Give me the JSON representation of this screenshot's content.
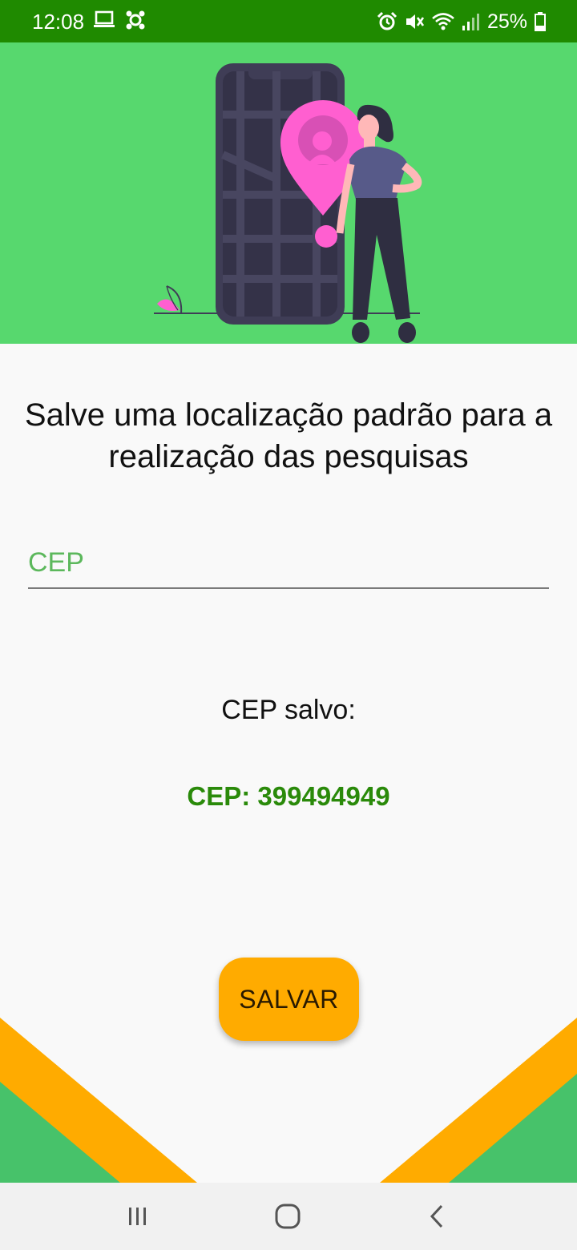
{
  "status_bar": {
    "time": "12:08",
    "battery_percent": "25%",
    "left_icons": [
      "laptop-icon",
      "app-notification-icon"
    ],
    "right_icons": [
      "alarm-icon",
      "mute-vibrate-icon",
      "wifi-icon",
      "signal-icon",
      "battery-icon"
    ],
    "background_color": "#1f8a00"
  },
  "hero": {
    "illustration": "woman-with-phone-map-pin-illustration",
    "background_color": "#57d86e"
  },
  "headline": "Salve uma localização padrão para a realização das pesquisas",
  "cep_input": {
    "placeholder": "CEP",
    "value": ""
  },
  "saved": {
    "label": "CEP salvo:",
    "value": "CEP: 399494949"
  },
  "save_button": {
    "label": "SALVAR",
    "color": "#ffab00"
  },
  "nav_bar": {
    "items": [
      "recent-apps-icon",
      "home-icon",
      "back-icon"
    ]
  }
}
